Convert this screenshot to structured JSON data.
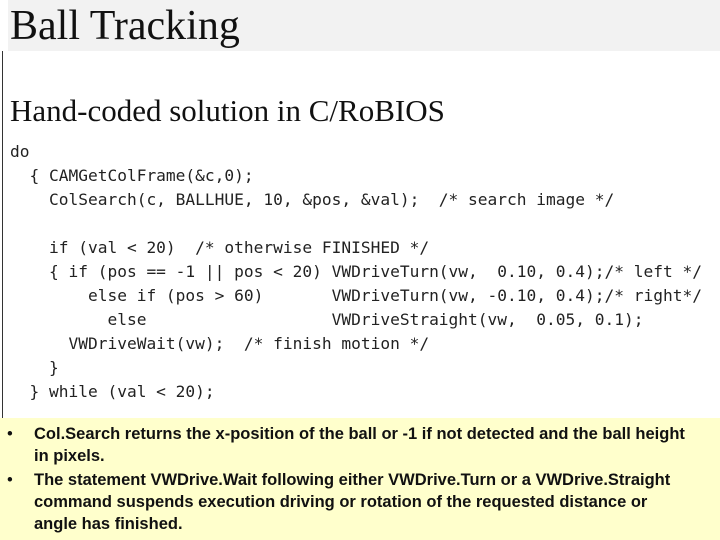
{
  "title": "Ball Tracking",
  "subtitle": "Hand-coded solution in C/RoBIOS",
  "code_lines": [
    "do",
    "  { CAMGetColFrame(&c,0);",
    "    ColSearch(c, BALLHUE, 10, &pos, &val);  /* search image */",
    "",
    "    if (val < 20)  /* otherwise FINISHED */",
    "    { if (pos == -1 || pos < 20) VWDriveTurn(vw,  0.10, 0.4);/* left */",
    "        else if (pos > 60)       VWDriveTurn(vw, -0.10, 0.4);/* right*/",
    "          else                   VWDriveStraight(vw,  0.05, 0.1);",
    "      VWDriveWait(vw);  /* finish motion */",
    "    }",
    "  } while (val < 20);"
  ],
  "bullets": [
    "Col.Search returns the x-position of the ball or -1 if not detected and the ball height in pixels.",
    "The statement VWDrive.Wait following either VWDrive.Turn or a VWDrive.Straight command suspends execution driving or rotation of the requested distance or angle has finished."
  ],
  "bullet_glyph": "•",
  "colors": {
    "notes_background": "#ffffcc",
    "title_band": "#f2f2f2"
  }
}
